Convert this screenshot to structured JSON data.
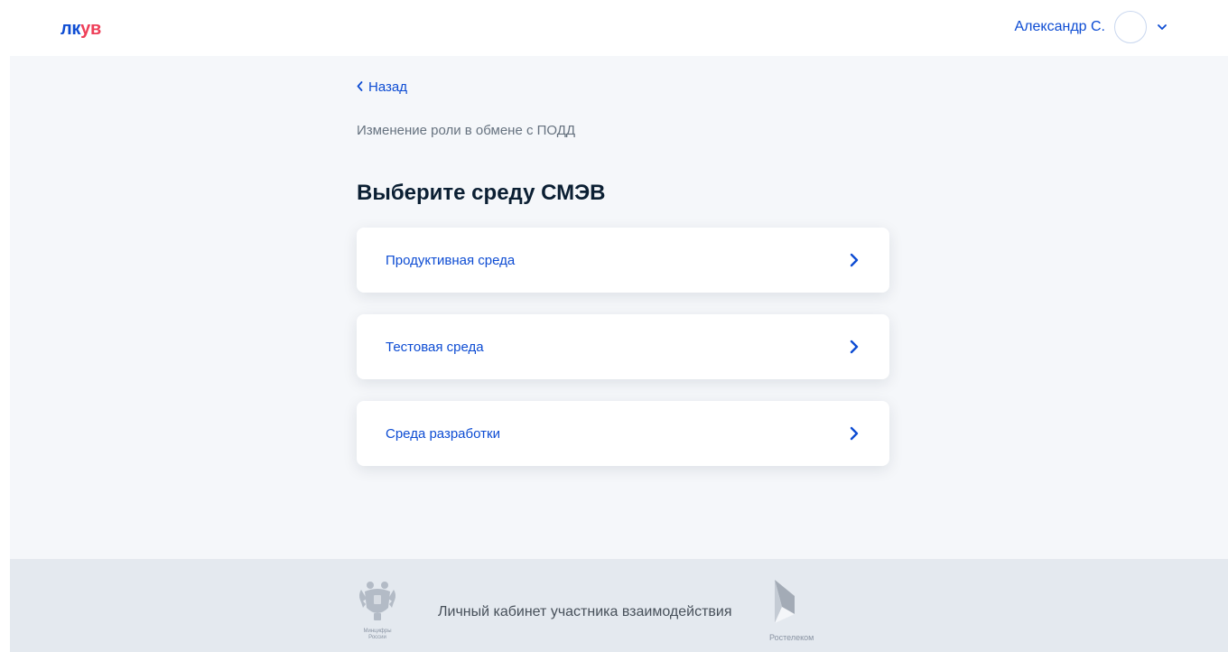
{
  "header": {
    "logo": {
      "part1": "лк",
      "part2": "ув"
    },
    "user_name": "Александр С."
  },
  "main": {
    "back_label": "Назад",
    "subtitle": "Изменение роли в обмене с ПОДД",
    "title": "Выберите среду СМЭВ",
    "options": [
      {
        "label": "Продуктивная среда"
      },
      {
        "label": "Тестовая среда"
      },
      {
        "label": "Среда разработки"
      }
    ]
  },
  "footer": {
    "emblem_caption_line1": "Минцифры",
    "emblem_caption_line2": "России",
    "text": "Личный кабинет участника взаимодействия",
    "partner": "Ростелеком"
  },
  "colors": {
    "accent": "#0d4cd3",
    "logo_red": "#ee3f58",
    "main_bg": "#f5f7fa",
    "footer_bg": "#e4e9ef"
  },
  "icons": {
    "back": "chevron-left-icon",
    "user_menu": "chevron-down-icon",
    "option": "chevron-right-icon",
    "emblem": "coat-of-arms-icon",
    "partner": "rostelecom-logo-icon"
  }
}
